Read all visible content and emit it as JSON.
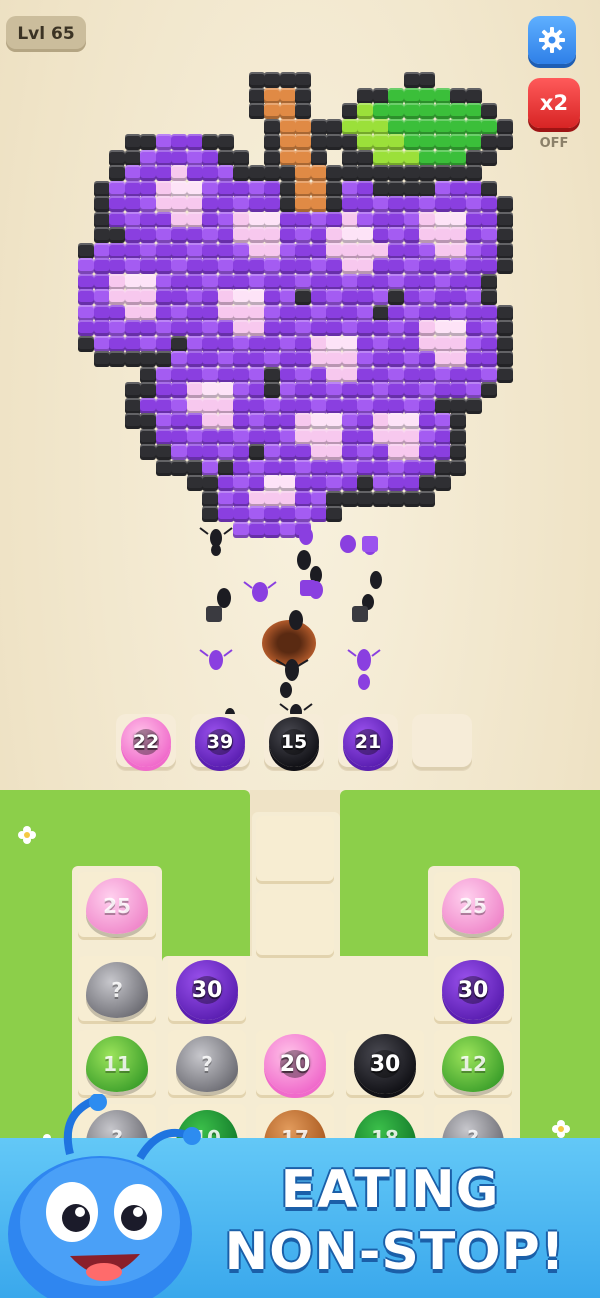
{
  "hud": {
    "level": "Lvl 65",
    "multiplier": "x2",
    "multiplier_state": "OFF",
    "settings_icon": "gear-icon"
  },
  "artwork": {
    "subject": "grape-bunch-pixel-art",
    "colors": {
      "outline": "#2f2f33",
      "purple": "#8a3fe0",
      "light_purple": "#a45cf2",
      "pink": "#f7c8ee",
      "light_pink": "#fde3f7",
      "stem": "#e08a45",
      "leaf": "#9be03a",
      "leaf_dark": "#3bbf3a"
    }
  },
  "holding_slots": [
    {
      "color": "pink",
      "count": "22"
    },
    {
      "color": "purple",
      "count": "39"
    },
    {
      "color": "black",
      "count": "15"
    },
    {
      "color": "purple",
      "count": "21"
    },
    {
      "color": "empty",
      "count": ""
    }
  ],
  "board": {
    "rows": [
      [
        {
          "type": "leaf",
          "color": "pink",
          "label": "25"
        },
        null,
        null,
        null,
        null,
        {
          "type": "leaf",
          "color": "pink",
          "label": "25"
        }
      ],
      [
        {
          "type": "leaf",
          "color": "gray",
          "label": "?"
        },
        {
          "type": "ring",
          "color": "purple",
          "label": "30"
        },
        null,
        null,
        null,
        {
          "type": "ring",
          "color": "purple",
          "label": "30"
        }
      ],
      [
        {
          "type": "leaf",
          "color": "green",
          "label": "11"
        },
        {
          "type": "leaf",
          "color": "gray",
          "label": "?"
        },
        {
          "type": "ring",
          "color": "pink",
          "label": "20"
        },
        {
          "type": "ring",
          "color": "black",
          "label": "30"
        },
        null,
        {
          "type": "leaf",
          "color": "green",
          "label": "12"
        }
      ],
      [
        {
          "type": "leaf",
          "color": "gray",
          "label": "?"
        },
        {
          "type": "leaf",
          "color": "darkgreen",
          "label": "10"
        },
        {
          "type": "leaf",
          "color": "brown",
          "label": "17"
        },
        {
          "type": "leaf",
          "color": "darkgreen",
          "label": "18"
        },
        null,
        {
          "type": "leaf",
          "color": "gray",
          "label": "?"
        }
      ]
    ]
  },
  "banner": {
    "line1": "EATING",
    "line2": "NON-STOP!",
    "mascot": "blue-ant-mascot"
  }
}
